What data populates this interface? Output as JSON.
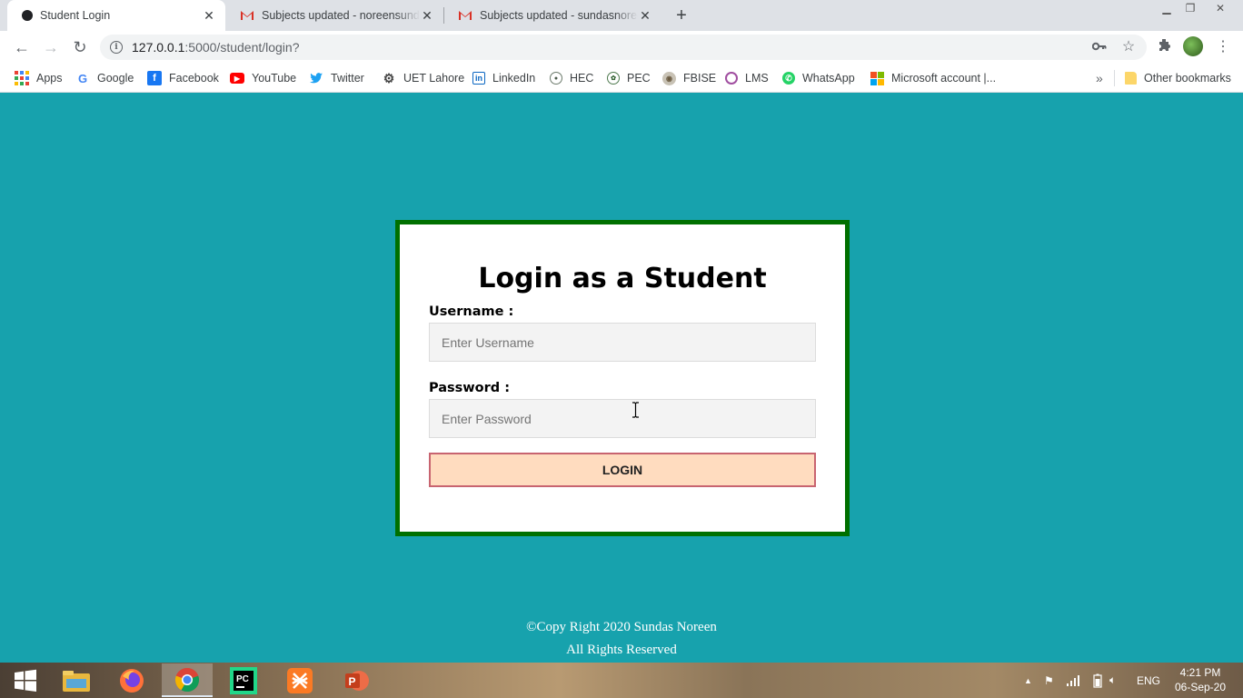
{
  "browser": {
    "tabs": [
      {
        "title": "Student Login",
        "active": true
      },
      {
        "title": "Subjects updated - noreensundas",
        "active": false
      },
      {
        "title": "Subjects updated - sundasnoreen",
        "active": false
      }
    ],
    "new_tab_icon": "plus-icon",
    "window_controls": [
      "minimize-icon",
      "restore-icon",
      "close-icon"
    ],
    "address_bar": {
      "host": "127.0.0.1",
      "path": ":5000/student/login?",
      "icons": [
        "info-icon",
        "key-icon",
        "star-icon"
      ]
    },
    "toolbar_icons": [
      "back-icon",
      "forward-icon",
      "reload-icon",
      "extensions-icon",
      "profile-avatar",
      "menu-icon"
    ],
    "bookmarks": [
      {
        "label": "Apps",
        "icon": "apps-grid-icon"
      },
      {
        "label": "Google",
        "icon": "google-icon"
      },
      {
        "label": "Facebook",
        "icon": "facebook-icon"
      },
      {
        "label": "YouTube",
        "icon": "youtube-icon"
      },
      {
        "label": "Twitter",
        "icon": "twitter-icon"
      },
      {
        "label": "UET Lahore",
        "icon": "uet-icon"
      },
      {
        "label": "LinkedIn",
        "icon": "linkedin-icon"
      },
      {
        "label": "HEC",
        "icon": "hec-icon"
      },
      {
        "label": "PEC",
        "icon": "pec-icon"
      },
      {
        "label": "FBISE",
        "icon": "fbise-icon"
      },
      {
        "label": "LMS",
        "icon": "lms-icon"
      },
      {
        "label": "WhatsApp",
        "icon": "whatsapp-icon"
      },
      {
        "label": "Microsoft account |...",
        "icon": "microsoft-icon"
      }
    ],
    "bookmarks_overflow": "»",
    "other_bookmarks": "Other bookmarks"
  },
  "login": {
    "title": "Login as a Student",
    "username_label": "Username :",
    "username_placeholder": "Enter Username",
    "password_label": "Password :",
    "password_placeholder": "Enter Password",
    "submit_label": "LOGIN"
  },
  "footer": {
    "line1": "©Copy Right 2020 Sundas Noreen",
    "line2": "All Rights Reserved"
  },
  "taskbar": {
    "apps": [
      "windows-start-icon",
      "file-explorer-icon",
      "firefox-icon",
      "chrome-icon",
      "pycharm-icon",
      "xampp-icon",
      "powerpoint-icon"
    ],
    "active_app": "chrome-icon",
    "language": "ENG",
    "time": "4:21 PM",
    "date": "06-Sep-20"
  },
  "colors": {
    "page_background": "#17a2ad",
    "card_border": "#007000",
    "button_background": "#ffdcbf",
    "button_border": "#c86470"
  }
}
